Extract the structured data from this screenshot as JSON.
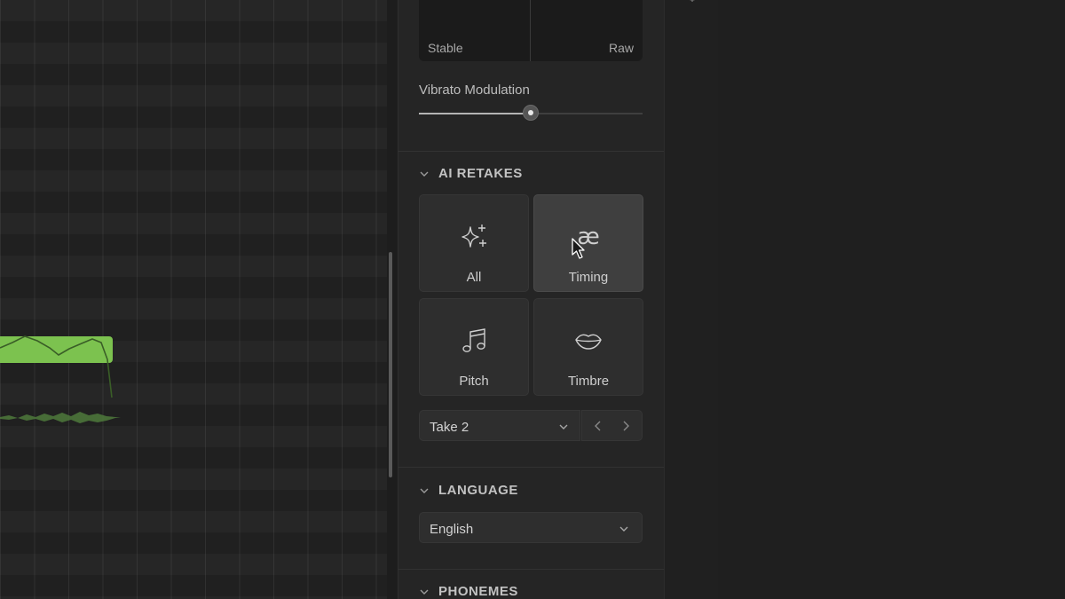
{
  "pitch_style": {
    "left_label": "Stable",
    "right_label": "Raw"
  },
  "vibrato": {
    "label": "Vibrato Modulation",
    "value_fraction": 0.5
  },
  "ai_retakes": {
    "title": "AI RETAKES",
    "tiles": [
      {
        "label": "All",
        "icon": "sparkles-icon"
      },
      {
        "label": "Timing",
        "icon": "ae-ligature-icon",
        "active": true
      },
      {
        "label": "Pitch",
        "icon": "music-notes-icon"
      },
      {
        "label": "Timbre",
        "icon": "lips-icon"
      }
    ],
    "take": {
      "value": "Take 2"
    }
  },
  "language": {
    "title": "LANGUAGE",
    "value": "English"
  },
  "phonemes": {
    "title": "PHONEMES"
  },
  "colors": {
    "accent_note": "#7cc24f",
    "panel": "#252525",
    "tile_active": "#3f3f3f"
  }
}
